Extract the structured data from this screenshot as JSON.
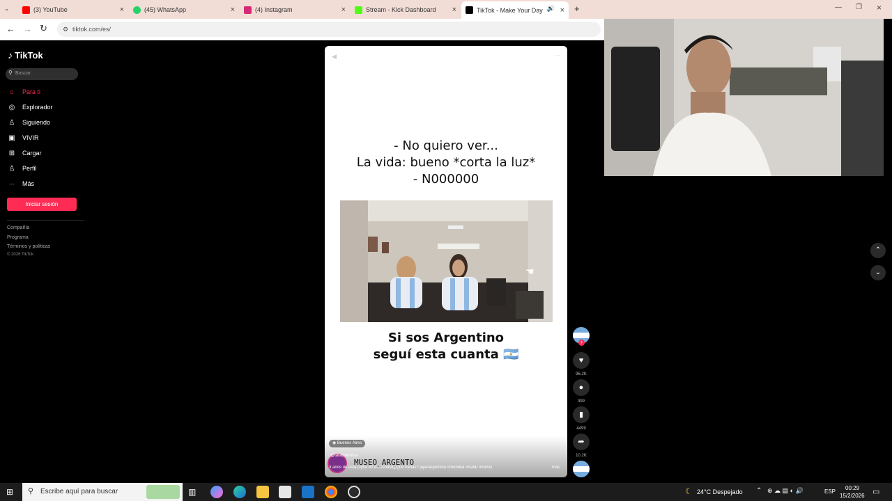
{
  "tabs": [
    {
      "label": "(3) YouTube",
      "color": "#ff0000"
    },
    {
      "label": "(45) WhatsApp",
      "color": "#25d366"
    },
    {
      "label": "(4) Instagram",
      "color": "#d62976"
    },
    {
      "label": "Stream - Kick Dashboard",
      "color": "#53fc18"
    },
    {
      "label": "TikTok - Make Your Day",
      "color": "#000000"
    }
  ],
  "address": "tiktok.com/es/",
  "tiktok": {
    "logo": "TikTok",
    "search_placeholder": "Buscar",
    "nav": [
      {
        "label": "Para ti",
        "icon": "home-icon",
        "glyph": "⌂",
        "active": true
      },
      {
        "label": "Explorador",
        "icon": "compass-icon",
        "glyph": "◎"
      },
      {
        "label": "Siguiendo",
        "icon": "following-icon",
        "glyph": "♙"
      },
      {
        "label": "VIVIR",
        "icon": "live-icon",
        "glyph": "▣"
      },
      {
        "label": "Cargar",
        "icon": "upload-icon",
        "glyph": "⊞"
      },
      {
        "label": "Perfil",
        "icon": "profile-icon",
        "glyph": "♙"
      },
      {
        "label": "Más",
        "icon": "more-icon",
        "glyph": "···"
      }
    ],
    "login_label": "Iniciar sesión",
    "footer": [
      "Compañía",
      "Programa",
      "Términos y políticas",
      "© 2026 TikTok"
    ]
  },
  "video": {
    "caption_top": [
      "- No quiero ver...",
      "La vida: bueno *corta la luz*",
      "- N000000"
    ],
    "caption_bottom": [
      "Si sos Argentino",
      "seguí esta cuanta 🇦🇷"
    ],
    "location": "Buenos Aires",
    "author": "MUSEO_ARGENTO",
    "author_handle": "@tarabsentina",
    "description": "3 años de esta joyita en el mundial¿Que harias? jaja#argentina #mundial #Katar #messi",
    "more": "más"
  },
  "actions": {
    "likes": "96.2K",
    "comments": "399",
    "saves": "4499",
    "shares": "10.2K"
  },
  "taskbar": {
    "search_placeholder": "Escribe aquí para buscar",
    "weather": "24°C  Despejado",
    "lang": "ESP",
    "time": "00:29",
    "date": "15/2/2026"
  },
  "colors": {
    "accent": "#fe2c55",
    "tabbar": "#f1dcd6"
  }
}
